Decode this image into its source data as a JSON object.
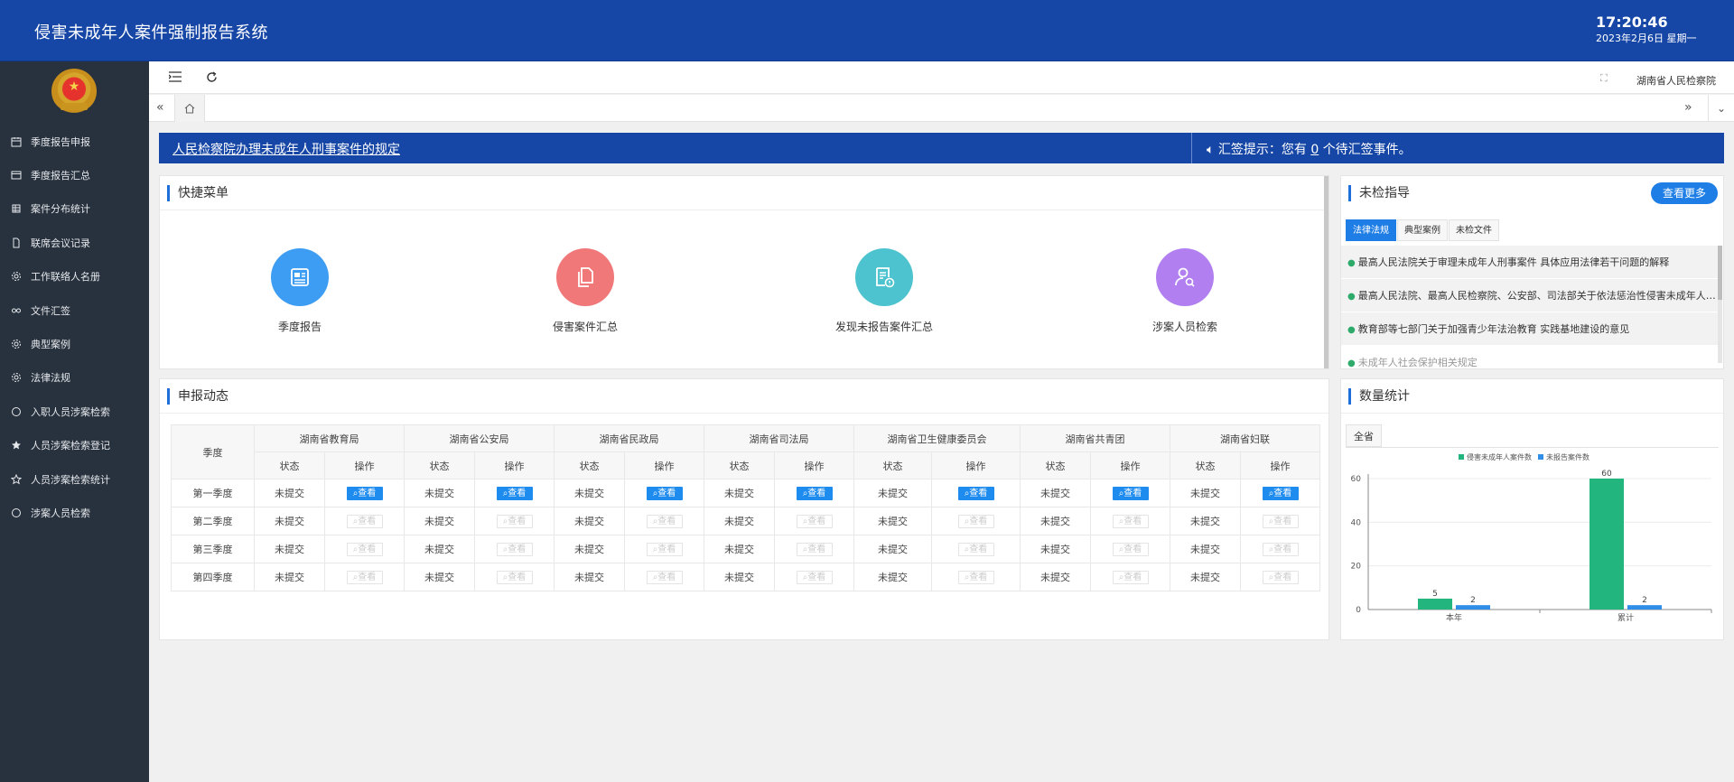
{
  "header": {
    "title": "侵害未成年人案件强制报告系统",
    "time": "17:20:46",
    "date": "2023年2月6日 星期一"
  },
  "sidebar": {
    "items": [
      {
        "label": "季度报告申报",
        "icon": "calendar-icon"
      },
      {
        "label": "季度报告汇总",
        "icon": "window-icon"
      },
      {
        "label": "案件分布统计",
        "icon": "grid-icon"
      },
      {
        "label": "联席会议记录",
        "icon": "file-icon"
      },
      {
        "label": "工作联络人名册",
        "icon": "gear-icon"
      },
      {
        "label": "文件汇签",
        "icon": "link-icon"
      },
      {
        "label": "典型案例",
        "icon": "gear-icon"
      },
      {
        "label": "法律法规",
        "icon": "gear-icon"
      },
      {
        "label": "入职人员涉案检索",
        "icon": "circle-icon"
      },
      {
        "label": "人员涉案检索登记",
        "icon": "star-filled-icon"
      },
      {
        "label": "人员涉案检索统计",
        "icon": "star-outline-icon"
      },
      {
        "label": "涉案人员检索",
        "icon": "circle-icon"
      }
    ]
  },
  "topbar": {
    "org": "湖南省人民检察院"
  },
  "notice": {
    "link": "人民检察院办理未成年人刑事案件的规定",
    "hint_prefix": "汇签提示：您有",
    "hint_count": "0",
    "hint_suffix": "个待汇签事件。"
  },
  "quick": {
    "title": "快捷菜单",
    "items": [
      {
        "label": "季度报告",
        "color": "#3d9df2",
        "icon": "newspaper-icon"
      },
      {
        "label": "侵害案件汇总",
        "color": "#f07878",
        "icon": "documents-icon"
      },
      {
        "label": "发现未报告案件汇总",
        "color": "#4cc3cf",
        "icon": "report-alert-icon"
      },
      {
        "label": "涉案人员检索",
        "color": "#b27ff0",
        "icon": "user-search-icon"
      }
    ]
  },
  "guide": {
    "title": "未检指导",
    "more": "查看更多",
    "tabs": [
      "法律法规",
      "典型案例",
      "未检文件"
    ],
    "items": [
      "最高人民法院关于审理未成年人刑事案件 具体应用法律若干问题的解释",
      "最高人民法院、最高人民检察院、公安部、司法部关于依法惩治性侵害未成年人犯罪的意见",
      "教育部等七部门关于加强青少年法治教育 实践基地建设的意见",
      "未成年人社会保护相关规定"
    ]
  },
  "reports": {
    "title": "申报动态",
    "season_header": "季度",
    "status_header": "状态",
    "op_header": "操作",
    "agencies": [
      "湖南省教育局",
      "湖南省公安局",
      "湖南省民政局",
      "湖南省司法局",
      "湖南省卫生健康委员会",
      "湖南省共青团",
      "湖南省妇联"
    ],
    "rows": [
      {
        "season": "第一季度",
        "status": "未提交",
        "view": "查看",
        "enabled": true
      },
      {
        "season": "第二季度",
        "status": "未提交",
        "view": "查看",
        "enabled": false
      },
      {
        "season": "第三季度",
        "status": "未提交",
        "view": "查看",
        "enabled": false
      },
      {
        "season": "第四季度",
        "status": "未提交",
        "view": "查看",
        "enabled": false
      }
    ]
  },
  "stats": {
    "title": "数量统计",
    "tab": "全省",
    "chart_data": {
      "type": "bar",
      "categories": [
        "本年",
        "累计"
      ],
      "series": [
        {
          "name": "侵害未成年人案件数",
          "values": [
            5,
            60
          ],
          "color": "#23b57e"
        },
        {
          "name": "未报告案件数",
          "values": [
            2,
            2
          ],
          "color": "#2e8ee8"
        }
      ],
      "ylim": [
        0,
        60
      ],
      "yticks": [
        0,
        20,
        40,
        60
      ],
      "legend": "top-center",
      "grid": true
    }
  }
}
